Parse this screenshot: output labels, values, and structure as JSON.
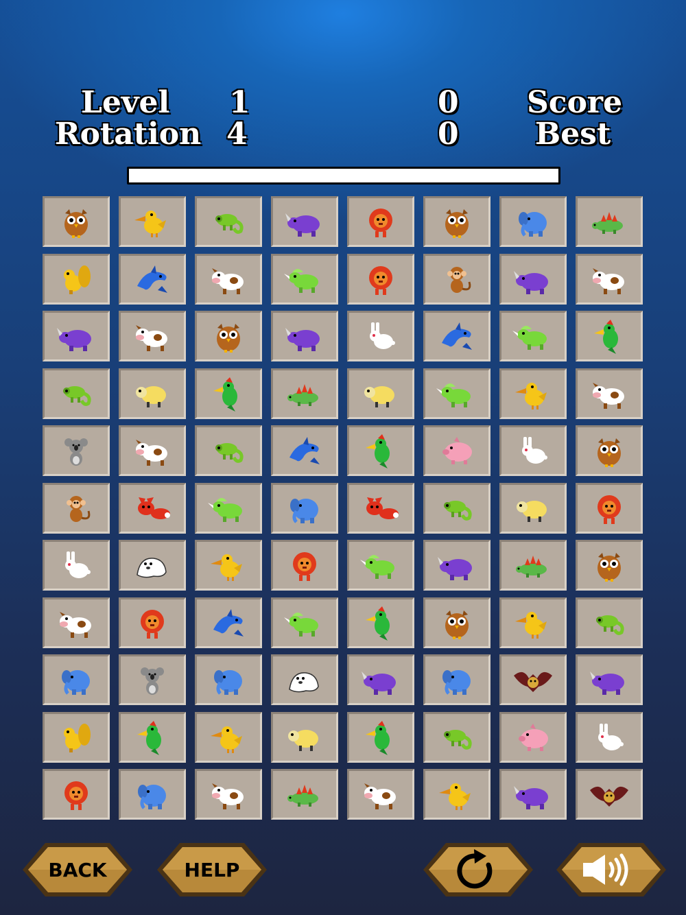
{
  "hud": {
    "level_label": "Level",
    "level_value": "1",
    "rotation_label": "Rotation",
    "rotation_value": "4",
    "score_label": "Score",
    "score_value": "0",
    "best_label": "Best",
    "best_value": "0",
    "progress_fraction": 0
  },
  "board": {
    "columns": 8,
    "rows": [
      [
        "owl",
        "pelican",
        "chameleon",
        "rhino",
        "lion",
        "owl",
        "elephant",
        "stegosaurus"
      ],
      [
        "squirrel",
        "dolphin",
        "cow",
        "triceratops",
        "lion",
        "monkey",
        "rhino",
        "cow"
      ],
      [
        "rhino",
        "cow",
        "owl",
        "rhino",
        "rabbit",
        "dolphin",
        "triceratops",
        "parrot"
      ],
      [
        "chameleon",
        "sheep",
        "parrot",
        "stegosaurus",
        "sheep",
        "triceratops",
        "pelican",
        "cow"
      ],
      [
        "koala",
        "cow",
        "chameleon",
        "dolphin",
        "parrot",
        "pig",
        "rabbit",
        "owl"
      ],
      [
        "monkey",
        "fox",
        "triceratops",
        "elephant",
        "fox",
        "chameleon",
        "sheep",
        "lion"
      ],
      [
        "rabbit",
        "seal",
        "pelican",
        "lion",
        "triceratops",
        "rhino",
        "stegosaurus",
        "owl"
      ],
      [
        "cow",
        "lion",
        "dolphin",
        "triceratops",
        "parrot",
        "owl",
        "pelican",
        "chameleon"
      ],
      [
        "elephant",
        "koala",
        "elephant",
        "seal",
        "rhino",
        "elephant",
        "bat",
        "rhino"
      ],
      [
        "squirrel",
        "parrot",
        "pelican",
        "sheep",
        "parrot",
        "chameleon",
        "pig",
        "rabbit"
      ],
      [
        "lion",
        "elephant",
        "cow",
        "stegosaurus",
        "cow",
        "pelican",
        "rhino",
        "bat"
      ]
    ]
  },
  "buttons": {
    "back_label": "BACK",
    "help_label": "HELP",
    "restart_icon": "rotate-arrow-icon",
    "sound_icon": "speaker-sound-on-icon"
  },
  "colors": {
    "tile": "#b6ab9f",
    "button_fill": "#b8893a",
    "button_border": "#4a3315"
  }
}
